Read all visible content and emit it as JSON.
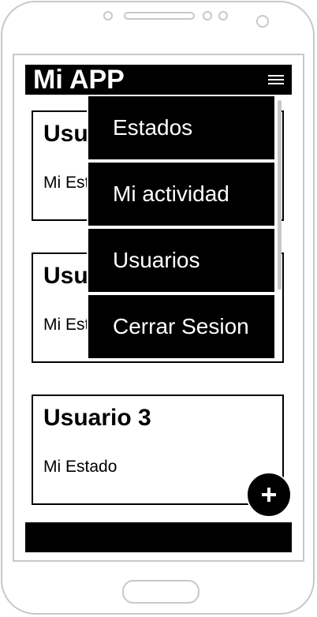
{
  "app": {
    "title": "Mi APP"
  },
  "cards": [
    {
      "title": "Usuario 1",
      "status": "Mi Estado"
    },
    {
      "title": "Usuario 2",
      "status": "Mi Estado"
    },
    {
      "title": "Usuario 3",
      "status": "Mi Estado"
    }
  ],
  "menu": {
    "items": [
      {
        "label": "Estados"
      },
      {
        "label": "Mi actividad"
      },
      {
        "label": "Usuarios"
      },
      {
        "label": "Cerrar Sesion"
      }
    ]
  },
  "icons": {
    "menu": "hamburger-icon",
    "fab": "plus-icon"
  },
  "colors": {
    "bar": "#000000",
    "text_on_bar": "#ffffff",
    "frame": "#c8c8c8"
  }
}
